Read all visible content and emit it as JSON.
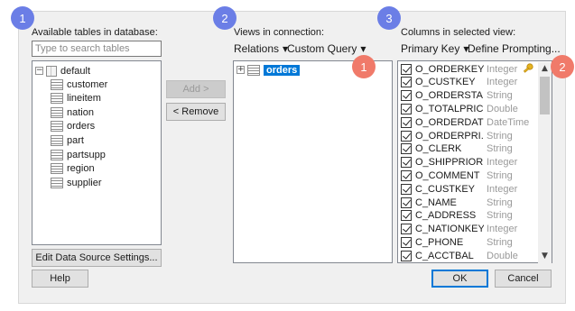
{
  "left_panel": {
    "label": "Available tables in database:",
    "search_placeholder": "Type to search tables",
    "root": "default",
    "tables": [
      "customer",
      "lineitem",
      "nation",
      "orders",
      "part",
      "partsupp",
      "region",
      "supplier"
    ],
    "edit_button": "Edit Data Source Settings..."
  },
  "middle_buttons": {
    "add": "Add >",
    "remove": "< Remove"
  },
  "views_panel": {
    "label": "Views in connection:",
    "menu_relations": "Relations",
    "menu_custom_query": "Custom Query",
    "views": [
      "orders"
    ]
  },
  "columns_panel": {
    "label": "Columns in selected view:",
    "menu_primary_key": "Primary Key",
    "menu_define_prompting": "Define Prompting...",
    "columns": [
      {
        "name": "O_ORDERKEY",
        "type": "Integer"
      },
      {
        "name": "O_CUSTKEY",
        "type": "Integer"
      },
      {
        "name": "O_ORDERSTA...",
        "type": "String"
      },
      {
        "name": "O_TOTALPRICE",
        "type": "Double"
      },
      {
        "name": "O_ORDERDATE",
        "type": "DateTime"
      },
      {
        "name": "O_ORDERPRI...",
        "type": "String"
      },
      {
        "name": "O_CLERK",
        "type": "String"
      },
      {
        "name": "O_SHIPPRIOR...",
        "type": "Integer"
      },
      {
        "name": "O_COMMENT",
        "type": "String"
      },
      {
        "name": "C_CUSTKEY",
        "type": "Integer"
      },
      {
        "name": "C_NAME",
        "type": "String"
      },
      {
        "name": "C_ADDRESS",
        "type": "String"
      },
      {
        "name": "C_NATIONKEY",
        "type": "Integer"
      },
      {
        "name": "C_PHONE",
        "type": "String"
      },
      {
        "name": "C_ACCTBAL",
        "type": "Double"
      }
    ]
  },
  "footer": {
    "help": "Help",
    "ok": "OK",
    "cancel": "Cancel"
  },
  "callouts": {
    "step1": "1",
    "step2": "2",
    "step3": "3",
    "red1": "1",
    "red2": "2"
  },
  "colors": {
    "step_blue": "#6b7ee6",
    "step_red": "#f07a6a",
    "selection": "#0078d7",
    "key": "#e6b422"
  }
}
